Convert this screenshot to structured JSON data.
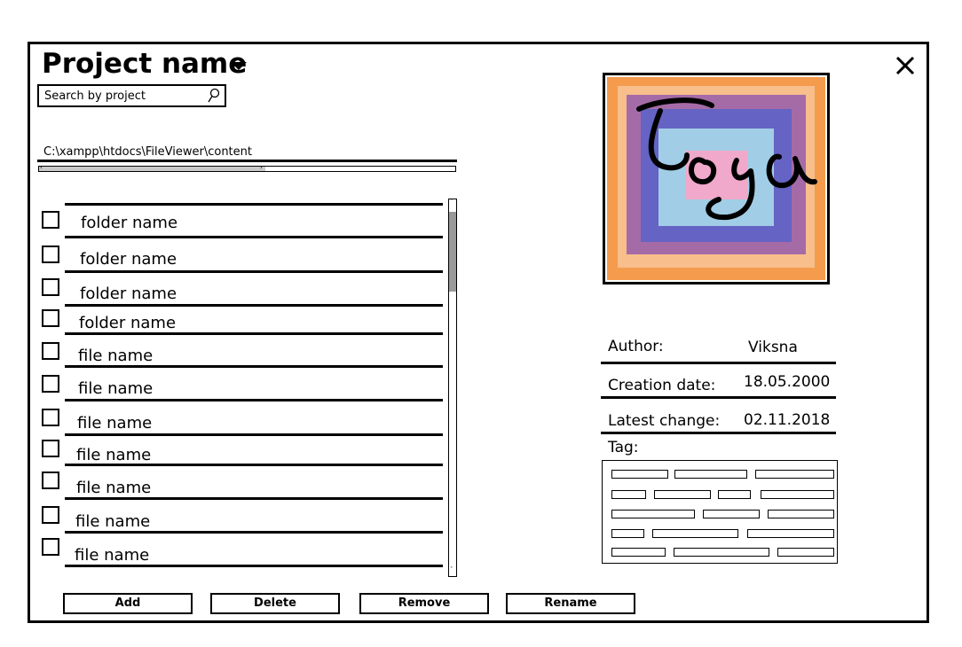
{
  "header": {
    "title": "Project name",
    "close_icon": "close-icon",
    "dropdown_icon": "caret-down-icon"
  },
  "search": {
    "placeholder": "Search by project",
    "icon": "search-icon"
  },
  "path": {
    "text": "C:\\xampp\\htdocs\\FileViewer\\content"
  },
  "items": [
    {
      "label": "folder name",
      "type": "folder"
    },
    {
      "label": "folder name",
      "type": "folder"
    },
    {
      "label": "folder name",
      "type": "folder"
    },
    {
      "label": "folder name",
      "type": "folder"
    },
    {
      "label": "file name",
      "type": "file"
    },
    {
      "label": "file name",
      "type": "file"
    },
    {
      "label": "file name",
      "type": "file"
    },
    {
      "label": "file name",
      "type": "file"
    },
    {
      "label": "file name",
      "type": "file"
    },
    {
      "label": "file name",
      "type": "file"
    },
    {
      "label": "file name",
      "type": "file"
    }
  ],
  "buttons": {
    "add": "Add",
    "delete": "Delete",
    "remove": "Remove",
    "rename": "Rename"
  },
  "logo": {
    "text": "Logo",
    "colors": [
      "#f28a2e",
      "#8a4fb0",
      "#4a5fd0",
      "#f4a6c8",
      "#a9d8ea"
    ]
  },
  "info": {
    "author_label": "Author:",
    "author_value": "Viksna",
    "creation_label": "Creation date:",
    "creation_value": "18.05.2000",
    "latest_label": "Latest change:",
    "latest_value": "02.11.2018",
    "tag_label": "Tag:"
  },
  "tags": {
    "rows": 5,
    "count": 17
  }
}
